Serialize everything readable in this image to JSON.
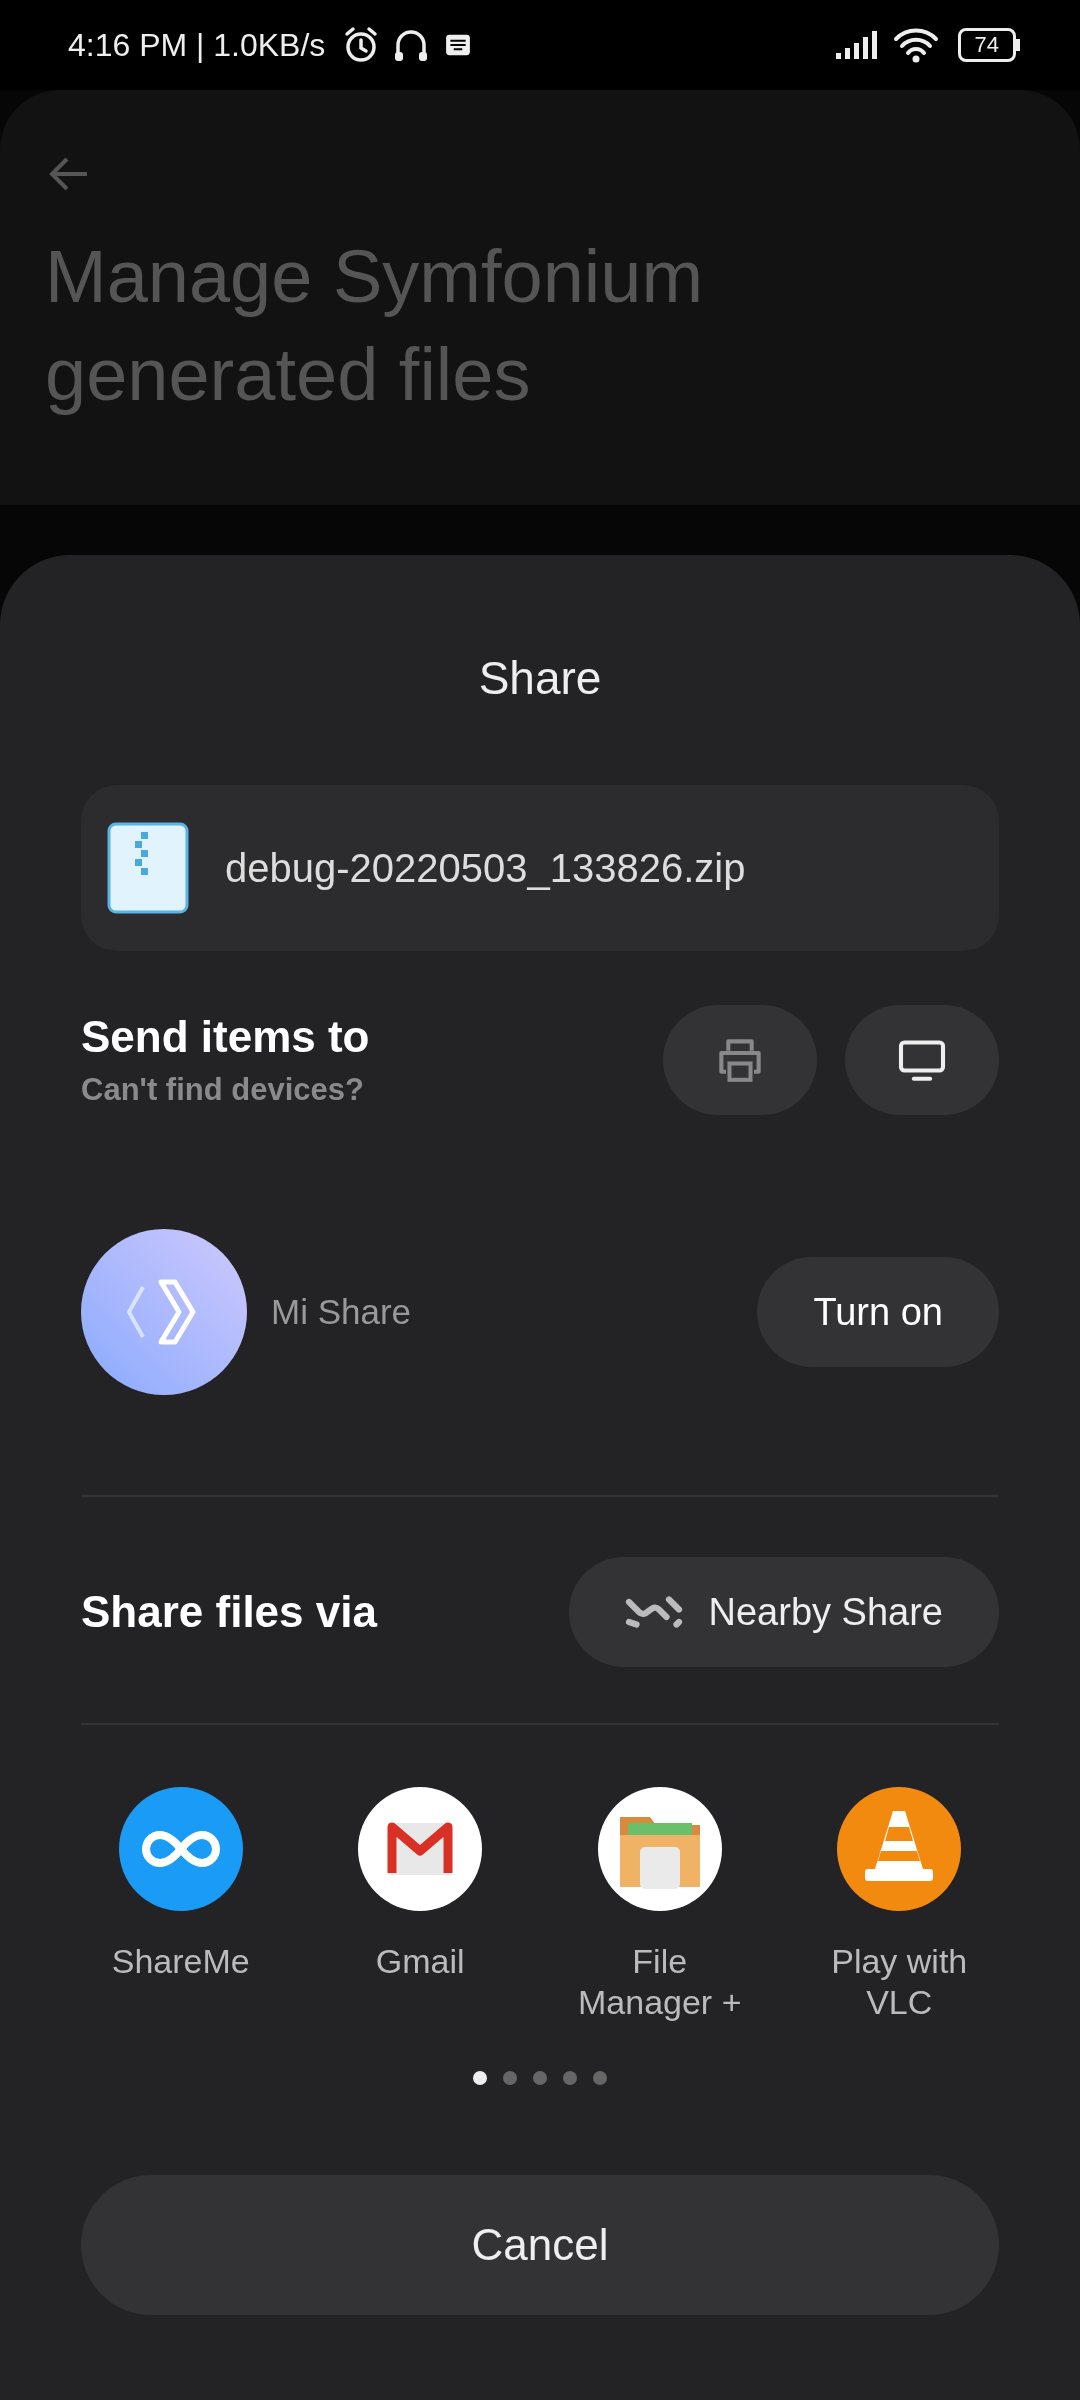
{
  "status_bar": {
    "time": "4:16 PM | 1.0KB/s",
    "battery": "74"
  },
  "page": {
    "title": "Manage Symfonium generated files"
  },
  "sheet": {
    "title": "Share",
    "file": {
      "name": "debug-20220503_133826.zip"
    },
    "send_items": {
      "title": "Send items to",
      "subtitle": "Can't find devices?"
    },
    "mi_share": {
      "label": "Mi Share",
      "button": "Turn on"
    },
    "share_via": {
      "title": "Share files via",
      "button": "Nearby Share"
    },
    "apps": [
      {
        "kind": "shareme",
        "name": "ShareMe"
      },
      {
        "kind": "gmail",
        "name": "Gmail"
      },
      {
        "kind": "files",
        "name": "File Manager +"
      },
      {
        "kind": "vlc",
        "name": "Play with VLC"
      }
    ],
    "pages": [
      {
        "selected": true
      },
      {
        "selected": false
      },
      {
        "selected": false
      },
      {
        "selected": false
      },
      {
        "selected": false
      }
    ],
    "cancel": "Cancel"
  }
}
